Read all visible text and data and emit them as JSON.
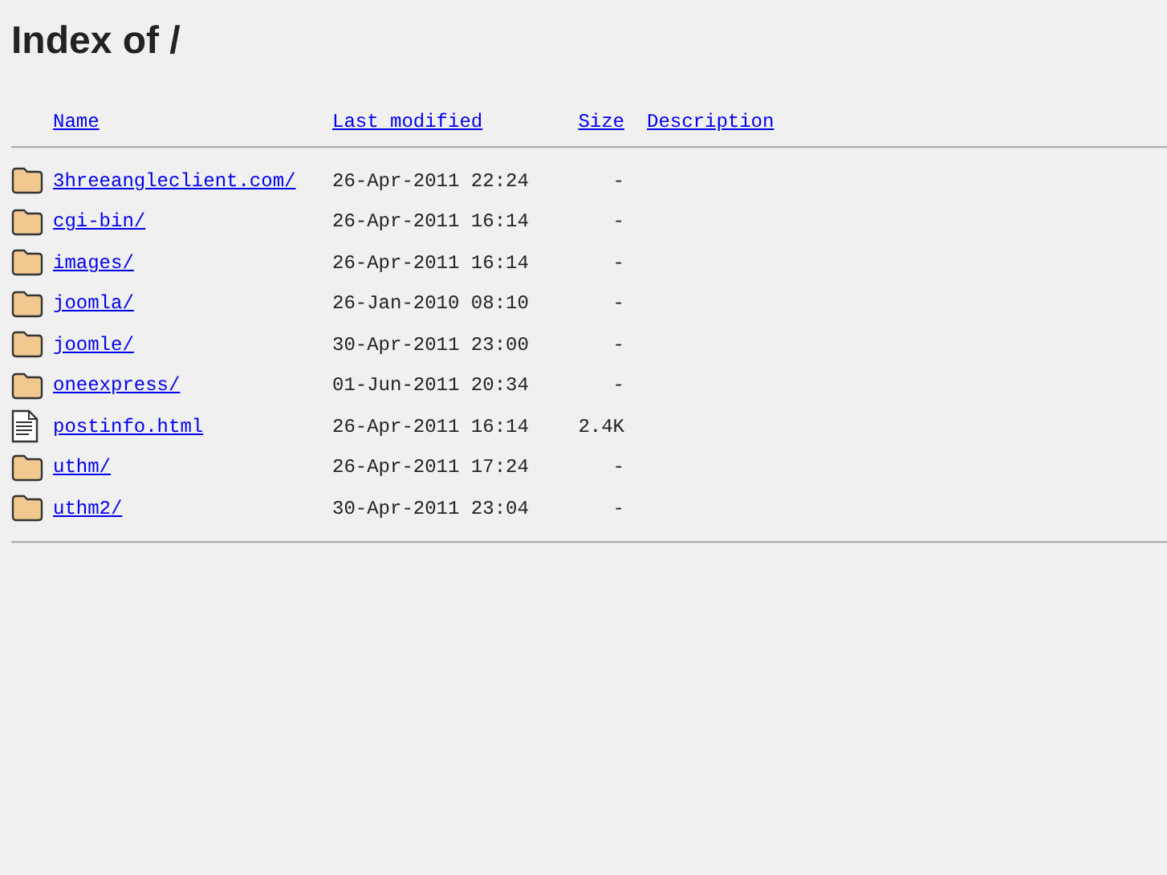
{
  "title": "Index of /",
  "columns": [
    "Name",
    "Last modified",
    "Size",
    "Description"
  ],
  "rows": [
    {
      "kind": "folder",
      "name": "3hreeangleclient.com/",
      "modified": "26-Apr-2011 22:24",
      "size": "-"
    },
    {
      "kind": "folder",
      "name": "cgi-bin/",
      "modified": "26-Apr-2011 16:14",
      "size": "-"
    },
    {
      "kind": "folder",
      "name": "images/",
      "modified": "26-Apr-2011 16:14",
      "size": "-"
    },
    {
      "kind": "folder",
      "name": "joomla/",
      "modified": "26-Jan-2010 08:10",
      "size": "-"
    },
    {
      "kind": "folder",
      "name": "joomle/",
      "modified": "30-Apr-2011 23:00",
      "size": "-"
    },
    {
      "kind": "folder",
      "name": "oneexpress/",
      "modified": "01-Jun-2011 20:34",
      "size": "-"
    },
    {
      "kind": "file",
      "name": "postinfo.html",
      "modified": "26-Apr-2011 16:14",
      "size": "2.4K"
    },
    {
      "kind": "folder",
      "name": "uthm/",
      "modified": "26-Apr-2011 17:24",
      "size": "-"
    },
    {
      "kind": "folder",
      "name": "uthm2/",
      "modified": "30-Apr-2011 23:04",
      "size": "-"
    }
  ]
}
